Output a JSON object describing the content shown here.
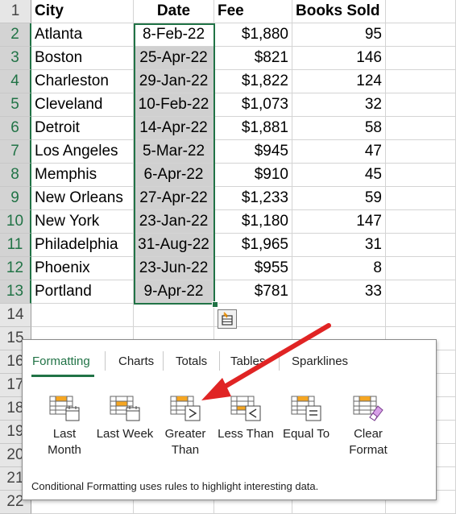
{
  "sheet": {
    "headers": [
      "City",
      "Date",
      "Fee",
      "Books Sold"
    ],
    "header_row_num": "1",
    "rows": [
      {
        "num": "2",
        "city": "Atlanta",
        "date": "8-Feb-22",
        "fee": "$1,880",
        "books": "95"
      },
      {
        "num": "3",
        "city": "Boston",
        "date": "25-Apr-22",
        "fee": "$821",
        "books": "146"
      },
      {
        "num": "4",
        "city": "Charleston",
        "date": "29-Jan-22",
        "fee": "$1,822",
        "books": "124"
      },
      {
        "num": "5",
        "city": "Cleveland",
        "date": "10-Feb-22",
        "fee": "$1,073",
        "books": "32"
      },
      {
        "num": "6",
        "city": "Detroit",
        "date": "14-Apr-22",
        "fee": "$1,881",
        "books": "58"
      },
      {
        "num": "7",
        "city": "Los Angeles",
        "date": "5-Mar-22",
        "fee": "$945",
        "books": "47"
      },
      {
        "num": "8",
        "city": "Memphis",
        "date": "6-Apr-22",
        "fee": "$910",
        "books": "45"
      },
      {
        "num": "9",
        "city": "New Orleans",
        "date": "27-Apr-22",
        "fee": "$1,233",
        "books": "59"
      },
      {
        "num": "10",
        "city": "New York",
        "date": "23-Jan-22",
        "fee": "$1,180",
        "books": "147"
      },
      {
        "num": "11",
        "city": "Philadelphia",
        "date": "31-Aug-22",
        "fee": "$1,965",
        "books": "31"
      },
      {
        "num": "12",
        "city": "Phoenix",
        "date": "23-Jun-22",
        "fee": "$955",
        "books": "8"
      },
      {
        "num": "13",
        "city": "Portland",
        "date": "9-Apr-22",
        "fee": "$781",
        "books": "33"
      }
    ],
    "extra_row_nums": [
      "14",
      "15",
      "16",
      "17",
      "18",
      "19",
      "20",
      "21",
      "22"
    ]
  },
  "quick_analysis": {
    "tabs": [
      "Formatting",
      "Charts",
      "Totals",
      "Tables",
      "Sparklines"
    ],
    "active_tab": "Formatting",
    "options": [
      {
        "label1": "Last",
        "label2": "Month",
        "icon": "calendar-icon"
      },
      {
        "label1": "Last Week",
        "label2": "",
        "icon": "calendar-icon"
      },
      {
        "label1": "Greater",
        "label2": "Than",
        "icon": "greater-than-icon"
      },
      {
        "label1": "Less Than",
        "label2": "",
        "icon": "less-than-icon"
      },
      {
        "label1": "Equal To",
        "label2": "",
        "icon": "equal-to-icon"
      },
      {
        "label1": "Clear",
        "label2": "Format",
        "icon": "eraser-icon"
      }
    ],
    "description": "Conditional Formatting uses rules to highlight interesting data."
  },
  "colors": {
    "accent": "#217346",
    "highlight": "#d0d0d0",
    "arrow": "#e02424",
    "icon_orange": "#f5a623"
  }
}
